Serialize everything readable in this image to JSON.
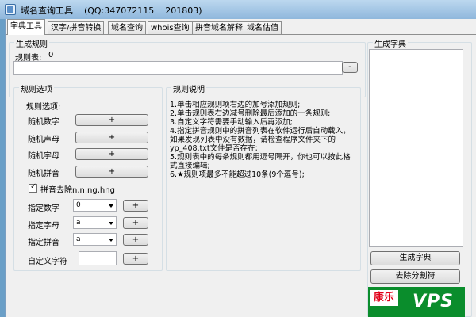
{
  "window": {
    "title": "域名查询工具    (QQ:347072115    201803)"
  },
  "tabs": [
    {
      "label": "字典工具",
      "active": true
    },
    {
      "label": "汉字/拼音转换"
    },
    {
      "label": "域名查询"
    },
    {
      "label": "whois查询"
    },
    {
      "label": "拼音域名解释"
    },
    {
      "label": "域名估值"
    }
  ],
  "generate_rules": {
    "title": "生成规则",
    "rules_label": "规则表:",
    "rules_count": "0",
    "rules_value": "",
    "minus_label": "-"
  },
  "rule_options": {
    "title": "规则选项",
    "subtitle": "规则选项:",
    "items": [
      {
        "label": "随机数字",
        "btn": "+"
      },
      {
        "label": "随机声母",
        "btn": "+"
      },
      {
        "label": "随机字母",
        "btn": "+"
      },
      {
        "label": "随机拼音",
        "btn": "+"
      }
    ],
    "pinyin_filter": {
      "label": "拼音去除n,n,ng,hng",
      "checked": true
    },
    "specified": [
      {
        "label": "指定数字",
        "value": "0",
        "btn": "+"
      },
      {
        "label": "指定字母",
        "value": "a",
        "btn": "+"
      },
      {
        "label": "指定拼音",
        "value": "a",
        "btn": "+"
      }
    ],
    "custom": {
      "label": "自定义字符",
      "value": "",
      "btn": "+"
    }
  },
  "rule_description": {
    "title": "规则说明",
    "lines": [
      "1.单击相应规则项右边的加号添加规则;",
      "2.单击规则表右边减号删除最后添加的一条规则;",
      "3.自定义字符需要手动输入后再添加;",
      "4.指定拼音规则中的拼音列表在软件运行后自动载入，如果发现列表中没有数据，请检查程序文件夹下的yp_408.txt文件是否存在;",
      "5.规则表中的每条规则都用逗号隔开，你也可以按此格式直接编辑;",
      "6.★规则项最多不能超过10条(9个逗号);"
    ]
  },
  "dictionary": {
    "title": "生成字典",
    "generate_btn": "生成字典",
    "remove_separator_btn": "去除分割符"
  },
  "ad": {
    "text_a": "康乐",
    "text_b": "VPS"
  }
}
